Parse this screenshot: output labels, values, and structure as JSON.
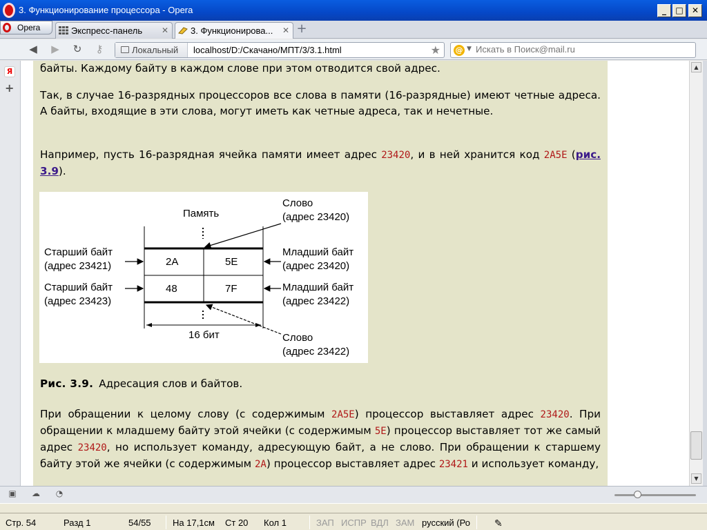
{
  "window": {
    "title": "3. Функционирование процессора - Opera",
    "controls": {
      "minimize": "_",
      "maximize": "□",
      "close": "✕"
    }
  },
  "tabbar": {
    "opera_menu": "Opera",
    "tabs": [
      {
        "label": "Экспресс-панель",
        "icon": "speed-dial-grid-icon",
        "active": false
      },
      {
        "label": "3. Функционирова...",
        "icon": "page-icon",
        "active": true
      }
    ],
    "new_tab": "+"
  },
  "navbar": {
    "badge": "Локальный",
    "url": "localhost/D:/Скачано/МПТ/3/3.1.html",
    "search_placeholder": "Искать в Поиск@mail.ru"
  },
  "sidebar": {
    "icons": [
      "yandex-icon",
      "add-panel-icon"
    ],
    "yandex_label": "Я"
  },
  "content": {
    "p0": "байты. Каждому байту в каждом слове при этом отводится свой адрес.",
    "p1": "Так, в случае 16-разрядных процессоров все слова в памяти (16-разрядные) имеют четные адреса. А байты, входящие в эти слова, могут иметь как четные адреса, так и нечетные.",
    "p2": {
      "t1": "Например, пусть 16-разрядная ячейка памяти имеет адрес ",
      "n1": "23420",
      "t2": ", и в ней хранится код ",
      "n2": "2A5E",
      "t3": " (",
      "link": "рис. 3.9",
      "t4": ")."
    },
    "figure": {
      "memory_label": "Память",
      "word_top_1": "Слово",
      "word_top_2": "(адрес 23420)",
      "hi1_1": "Старший байт",
      "hi1_2": "(адрес 23421)",
      "hi2_1": "Старший байт",
      "hi2_2": "(адрес 23423)",
      "lo1_1": "Младший байт",
      "lo1_2": "(адрес 23420)",
      "lo2_1": "Младший байт",
      "lo2_2": "(адрес 23422)",
      "c11": "2A",
      "c12": "5E",
      "c21": "48",
      "c22": "7F",
      "bits": "16 бит",
      "word_bot_1": "Слово",
      "word_bot_2": "(адрес 23422)"
    },
    "caption_num": "Рис. 3.9.",
    "caption_text": "Адресация слов и байтов.",
    "p3": {
      "a": "При обращении к целому слову (с содержимым ",
      "n1": "2A5E",
      "b": ") процессор выставляет адрес ",
      "n2": "23420",
      "c": ". При обращении к младшему байту этой ячейки (с содержимым ",
      "n3": "5E",
      "d": ") процессор выставляет тот же самый адрес ",
      "n4": "23420",
      "e": ", но использует команду, адресующую байт, а не слово. При обращении к старшему байту этой же ячейки (с содержимым ",
      "n5": "2A",
      "f": ") процессор выставляет адрес ",
      "n6": "23421",
      "g": " и использует команду,"
    }
  },
  "scrollbar": {
    "up": "▲",
    "down": "▼"
  },
  "opera_status": {
    "icons": [
      "panel-toggle-icon",
      "cloud-icon",
      "speedometer-icon"
    ]
  },
  "word_status": {
    "page": "Стр. 54",
    "section": "Разд 1",
    "pages": "54/55",
    "position": "На 17,1см",
    "line": "Ст 20",
    "col": "Кол 1",
    "rec": "ЗАП",
    "trk": "ИСПР",
    "ext": "ВДЛ",
    "ovr": "ЗАМ",
    "lang": "русский (Ро"
  }
}
